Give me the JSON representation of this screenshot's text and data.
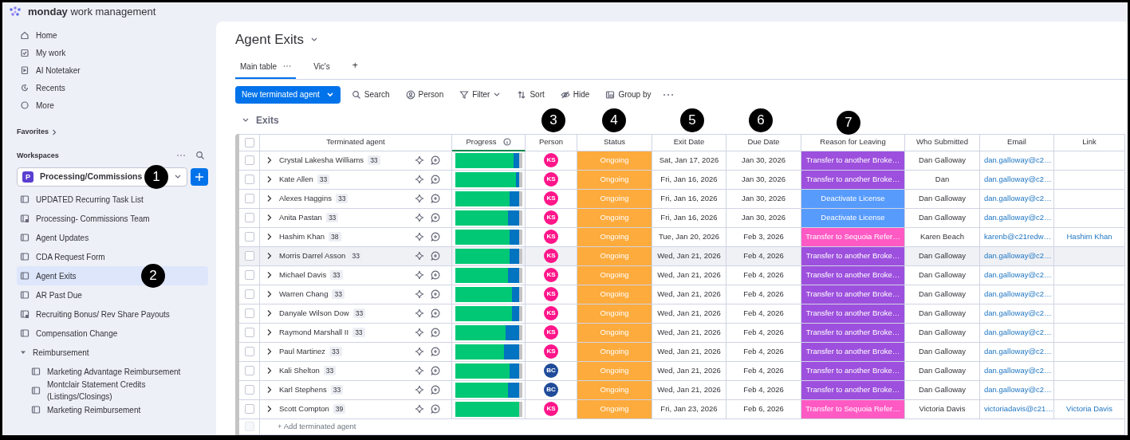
{
  "app": {
    "brand": "**monday** work management"
  },
  "sidebar": {
    "nav": [
      {
        "label": "Home"
      },
      {
        "label": "My work"
      },
      {
        "label": "AI Notetaker"
      },
      {
        "label": "Recents"
      },
      {
        "label": "More"
      }
    ],
    "favorites": "Favorites",
    "workspaces_heading": "Workspaces",
    "workspace": {
      "badge": "P",
      "name": "Processing/Commissions"
    },
    "boards": [
      {
        "label": "UPDATED Recurring Task List",
        "locked": false,
        "selected": false
      },
      {
        "label": "Processing- Commissions Team",
        "locked": true,
        "selected": false
      },
      {
        "label": "Agent Updates",
        "locked": false,
        "selected": false
      },
      {
        "label": "CDA Request Form",
        "locked": false,
        "selected": false
      },
      {
        "label": "Agent Exits",
        "locked": false,
        "selected": true
      },
      {
        "label": "AR Past Due",
        "locked": false,
        "selected": false
      },
      {
        "label": "Recruiting Bonus/ Rev Share Payouts",
        "locked": true,
        "selected": false
      },
      {
        "label": "Compensation Change",
        "locked": false,
        "selected": false
      },
      {
        "label": "Reimbursement",
        "kind": "folder",
        "expanded": true,
        "children": [
          {
            "label": "Marketing Advantage Reimbursement",
            "locked": false,
            "selected": false
          },
          {
            "label": "Montclair Statement Credits (Listings/Closings)",
            "locked": false,
            "selected": false
          },
          {
            "label": "Marketing Reimbursement",
            "locked": false,
            "selected": false
          }
        ]
      }
    ]
  },
  "board": {
    "title": "Agent Exits",
    "views": [
      {
        "label": "Main table",
        "selected": true
      },
      {
        "label": "Vic's",
        "selected": false
      }
    ],
    "add_view": "+",
    "toolbar": {
      "new_button": "New terminated agent",
      "actions": [
        "Search",
        "Person",
        "Filter",
        "Sort",
        "Hide",
        "Group by"
      ]
    },
    "group": {
      "title": "Exits",
      "expanded": true
    },
    "columns": [
      "Terminated agent",
      "Progress",
      "Person",
      "Status",
      "Exit Date",
      "Due Date",
      "Reason for Leaving",
      "Who Submitted",
      "Email",
      "Link"
    ],
    "rows": [
      {
        "name": "Crystal Lakesha Williams",
        "count": "33",
        "checked": false,
        "highlighted": false,
        "progress": {
          "level": 0.88
        },
        "person": {
          "initials": "KS",
          "color": "#ff158a"
        },
        "status": {
          "label": "Ongoing",
          "color": "#fdab3d"
        },
        "exit_date": "Sat, Jan 17, 2026",
        "due_date": "Jan 30, 2026",
        "reason": {
          "label": "Transfer to another Broke…",
          "color": "#9d50dd"
        },
        "submitted_by": "Dan Galloway",
        "email": "dan.galloway@c2…"
      },
      {
        "name": "Kate Allen",
        "count": "33",
        "checked": false,
        "highlighted": false,
        "progress": {
          "level": 0.91
        },
        "person": {
          "initials": "KS",
          "color": "#ff158a"
        },
        "status": {
          "label": "Ongoing",
          "color": "#fdab3d"
        },
        "exit_date": "Fri, Jan 16, 2026",
        "due_date": "Jan 30, 2026",
        "reason": {
          "label": "Transfer to another Broke…",
          "color": "#9d50dd"
        },
        "submitted_by": "Dan",
        "email": "dan.galloway@c2…"
      },
      {
        "name": "Alexes Haggins",
        "count": "33",
        "checked": false,
        "highlighted": false,
        "progress": {
          "level": 0.82
        },
        "person": {
          "initials": "KS",
          "color": "#ff158a"
        },
        "status": {
          "label": "Ongoing",
          "color": "#fdab3d"
        },
        "exit_date": "Fri, Jan 16, 2026",
        "due_date": "Jan 30, 2026",
        "reason": {
          "label": "Deactivate License",
          "color": "#579bfc"
        },
        "submitted_by": "Dan Galloway",
        "email": "dan.galloway@c2…"
      },
      {
        "name": "Anita Pastan",
        "count": "33",
        "checked": false,
        "highlighted": false,
        "progress": {
          "level": 0.79
        },
        "person": {
          "initials": "KS",
          "color": "#ff158a"
        },
        "status": {
          "label": "Ongoing",
          "color": "#fdab3d"
        },
        "exit_date": "Fri, Jan 16, 2026",
        "due_date": "Jan 30, 2026",
        "reason": {
          "label": "Deactivate License",
          "color": "#579bfc"
        },
        "submitted_by": "Dan Galloway",
        "email": "dan.galloway@c2…"
      },
      {
        "name": "Hashim Khan",
        "count": "38",
        "checked": false,
        "highlighted": false,
        "progress": {
          "level": 0.81
        },
        "person": {
          "initials": "KS",
          "color": "#ff158a"
        },
        "status": {
          "label": "Ongoing",
          "color": "#fdab3d"
        },
        "exit_date": "Tue, Jan 20, 2026",
        "due_date": "Feb 3, 2026",
        "reason": {
          "label": "Transfer to Sequoia Refer…",
          "color": "#ff5ac4"
        },
        "submitted_by": "Karen Beach",
        "email": "karenb@c21redw…",
        "link": "Hashim Khan"
      },
      {
        "name": "Morris Darrel Asson",
        "count": "33",
        "checked": false,
        "highlighted": true,
        "progress": {
          "level": 0.82
        },
        "person": {
          "initials": "KS",
          "color": "#ff158a"
        },
        "status": {
          "label": "Ongoing",
          "color": "#fdab3d"
        },
        "exit_date": "Wed, Jan 21, 2026",
        "due_date": "Feb 4, 2026",
        "reason": {
          "label": "Transfer to another Broke…",
          "color": "#9d50dd"
        },
        "submitted_by": "Dan Galloway",
        "email": "dan.galloway@c2…"
      },
      {
        "name": "Michael Davis",
        "count": "33",
        "checked": false,
        "highlighted": false,
        "progress": {
          "level": 0.79
        },
        "person": {
          "initials": "KS",
          "color": "#ff158a"
        },
        "status": {
          "label": "Ongoing",
          "color": "#fdab3d"
        },
        "exit_date": "Wed, Jan 21, 2026",
        "due_date": "Feb 4, 2026",
        "reason": {
          "label": "Transfer to another Broke…",
          "color": "#9d50dd"
        },
        "submitted_by": "Dan Galloway",
        "email": "dan.galloway@c2…"
      },
      {
        "name": "Warren Chang",
        "count": "33",
        "checked": false,
        "highlighted": false,
        "progress": {
          "level": 0.85
        },
        "person": {
          "initials": "KS",
          "color": "#ff158a"
        },
        "status": {
          "label": "Ongoing",
          "color": "#fdab3d"
        },
        "exit_date": "Wed, Jan 21, 2026",
        "due_date": "Feb 4, 2026",
        "reason": {
          "label": "Transfer to another Broke…",
          "color": "#9d50dd"
        },
        "submitted_by": "Dan Galloway",
        "email": "dan.galloway@c2…"
      },
      {
        "name": "Danyale Wilson Dow",
        "count": "33",
        "checked": false,
        "highlighted": false,
        "progress": {
          "level": 0.85
        },
        "person": {
          "initials": "KS",
          "color": "#ff158a"
        },
        "status": {
          "label": "Ongoing",
          "color": "#fdab3d"
        },
        "exit_date": "Wed, Jan 21, 2026",
        "due_date": "Feb 4, 2026",
        "reason": {
          "label": "Transfer to another Broke…",
          "color": "#9d50dd"
        },
        "submitted_by": "Dan Galloway",
        "email": "dan.galloway@c2…"
      },
      {
        "name": "Raymond Marshall II",
        "count": "33",
        "checked": false,
        "highlighted": false,
        "progress": {
          "level": 0.76
        },
        "person": {
          "initials": "KS",
          "color": "#ff158a"
        },
        "status": {
          "label": "Ongoing",
          "color": "#fdab3d"
        },
        "exit_date": "Wed, Jan 21, 2026",
        "due_date": "Feb 4, 2026",
        "reason": {
          "label": "Transfer to another Broke…",
          "color": "#9d50dd"
        },
        "submitted_by": "Dan Galloway",
        "email": "dan.galloway@c2…"
      },
      {
        "name": "Paul Martinez",
        "count": "33",
        "checked": false,
        "highlighted": false,
        "progress": {
          "level": 0.73
        },
        "person": {
          "initials": "KS",
          "color": "#ff158a"
        },
        "status": {
          "label": "Ongoing",
          "color": "#fdab3d"
        },
        "exit_date": "Wed, Jan 21, 2026",
        "due_date": "Feb 4, 2026",
        "reason": {
          "label": "Transfer to another Broke…",
          "color": "#9d50dd"
        },
        "submitted_by": "Dan Galloway",
        "email": "dan.galloway@c2…"
      },
      {
        "name": "Kali Shelton",
        "count": "33",
        "checked": false,
        "highlighted": false,
        "progress": {
          "level": 0.82
        },
        "person": {
          "initials": "BC",
          "color": "#1f4b99"
        },
        "status": {
          "label": "Ongoing",
          "color": "#fdab3d"
        },
        "exit_date": "Wed, Jan 21, 2026",
        "due_date": "Feb 4, 2026",
        "reason": {
          "label": "Transfer to another Broke…",
          "color": "#9d50dd"
        },
        "submitted_by": "Dan Galloway",
        "email": "dan.galloway@c2…"
      },
      {
        "name": "Karl Stephens",
        "count": "33",
        "checked": false,
        "highlighted": false,
        "progress": {
          "level": 0.79
        },
        "person": {
          "initials": "BC",
          "color": "#1f4b99"
        },
        "status": {
          "label": "Ongoing",
          "color": "#fdab3d"
        },
        "exit_date": "Wed, Jan 21, 2026",
        "due_date": "Feb 4, 2026",
        "reason": {
          "label": "Transfer to another Broke…",
          "color": "#9d50dd"
        },
        "submitted_by": "Dan Galloway",
        "email": "dan.galloway@c2…"
      },
      {
        "name": "Scott Compton",
        "count": "39",
        "checked": false,
        "highlighted": false,
        "progress": {
          "level": 0.96
        },
        "person": {
          "initials": "KS",
          "color": "#ff158a"
        },
        "status": {
          "label": "Ongoing",
          "color": "#fdab3d"
        },
        "exit_date": "Fri, Jan 23, 2026",
        "due_date": "Feb 6, 2026",
        "reason": {
          "label": "Transfer to Sequoia Refer…",
          "color": "#ff5ac4"
        },
        "submitted_by": "Victoria Davis",
        "email": "victoriadavis@c21…",
        "link": "Victoria Davis"
      }
    ],
    "select_all_checked": false,
    "add_row": {
      "label": "+ Add terminated agent",
      "checkbox_disabled": true
    }
  },
  "callouts": [
    "1",
    "2",
    "3",
    "4",
    "5",
    "6",
    "7"
  ]
}
